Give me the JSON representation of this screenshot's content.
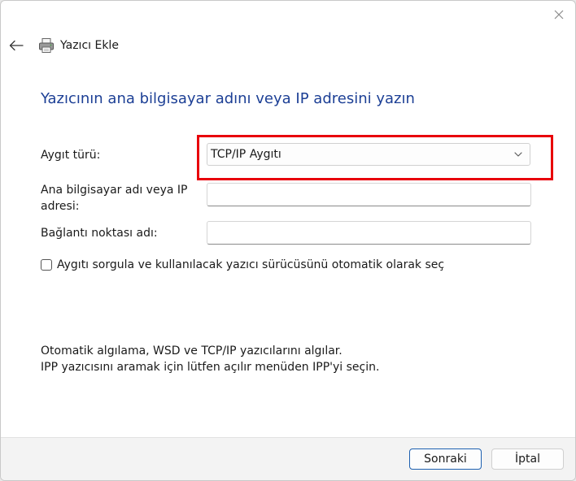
{
  "window": {
    "title": "Yazıcı Ekle"
  },
  "page": {
    "heading": "Yazıcının ana bilgisayar adını veya IP adresini yazın"
  },
  "form": {
    "device_type_label": "Aygıt türü:",
    "device_type_value": "TCP/IP Aygıtı",
    "hostname_label": "Ana bilgisayar adı veya IP adresi:",
    "hostname_value": "",
    "port_label": "Bağlantı noktası adı:",
    "port_value": "",
    "auto_select_label": "Aygıtı sorgula ve kullanılacak yazıcı sürücüsünü otomatik olarak seç",
    "auto_select_checked": false
  },
  "info": {
    "line1": "Otomatik algılama, WSD ve TCP/IP yazıcılarını algılar.",
    "line2": "IPP yazıcısını aramak için lütfen açılır menüden IPP'yi seçin."
  },
  "footer": {
    "next_label": "Sonraki",
    "cancel_label": "İptal"
  },
  "icons": {
    "close": "close-icon",
    "back": "arrow-left-icon",
    "printer": "printer-icon",
    "dropdown": "chevron-down-icon"
  },
  "colors": {
    "heading": "#1c3f95",
    "highlight": "#e8000a",
    "primary_button_border": "#1c5fb0"
  }
}
